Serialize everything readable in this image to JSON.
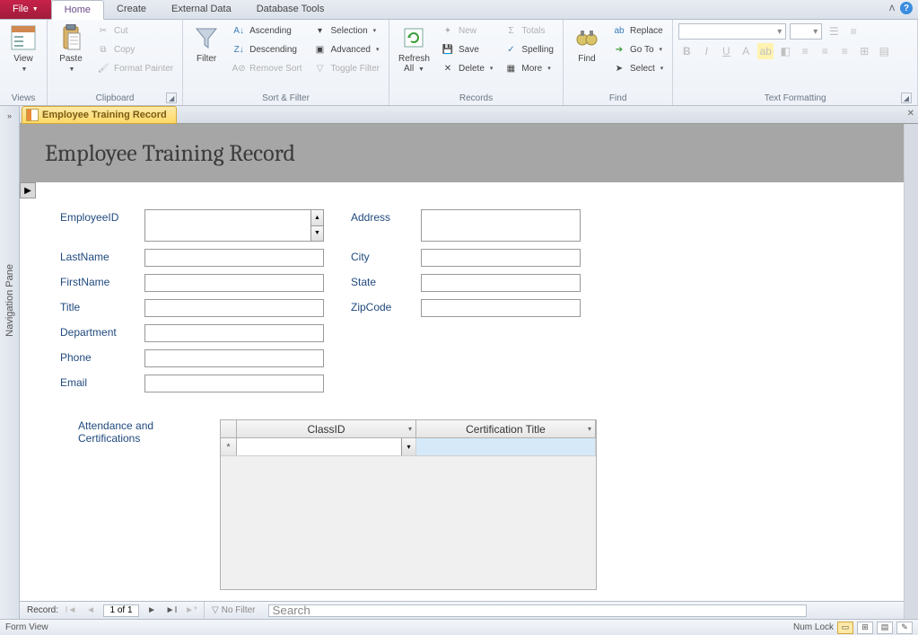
{
  "tabs": {
    "file": "File",
    "home": "Home",
    "create": "Create",
    "external": "External Data",
    "dbtools": "Database Tools"
  },
  "ribbon": {
    "views": {
      "view": "View",
      "group": "Views"
    },
    "clipboard": {
      "paste": "Paste",
      "cut": "Cut",
      "copy": "Copy",
      "painter": "Format Painter",
      "group": "Clipboard"
    },
    "sortfilter": {
      "filter": "Filter",
      "asc": "Ascending",
      "desc": "Descending",
      "remove": "Remove Sort",
      "selection": "Selection",
      "advanced": "Advanced",
      "toggle": "Toggle Filter",
      "group": "Sort & Filter"
    },
    "records": {
      "refresh": "Refresh\nAll",
      "new": "New",
      "save": "Save",
      "delete": "Delete",
      "totals": "Totals",
      "spelling": "Spelling",
      "more": "More",
      "group": "Records"
    },
    "find": {
      "find": "Find",
      "replace": "Replace",
      "goto": "Go To",
      "select": "Select",
      "group": "Find"
    },
    "textfmt": {
      "group": "Text Formatting"
    }
  },
  "navpane": "Navigation Pane",
  "doctab": "Employee Training Record",
  "form": {
    "title": "Employee Training Record",
    "labels": {
      "employeeid": "EmployeeID",
      "lastname": "LastName",
      "firstname": "FirstName",
      "title": "Title",
      "department": "Department",
      "phone": "Phone",
      "email": "Email",
      "address": "Address",
      "city": "City",
      "state": "State",
      "zip": "ZipCode",
      "attendance": "Attendance and Certifications"
    },
    "subform": {
      "col1": "ClassID",
      "col2": "Certification Title"
    }
  },
  "recnav": {
    "label": "Record:",
    "pos": "1 of 1",
    "nofilter": "No Filter",
    "search": "Search"
  },
  "status": {
    "left": "Form View",
    "numlock": "Num Lock"
  }
}
